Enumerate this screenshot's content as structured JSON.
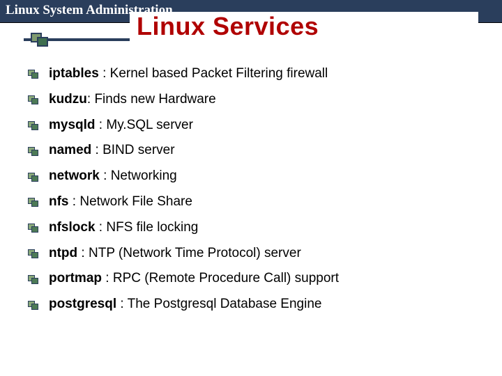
{
  "header": "Linux System Administration",
  "title": "Linux Services",
  "services": [
    {
      "name": "iptables",
      "sep": " : ",
      "desc": "Kernel based Packet Filtering firewall"
    },
    {
      "name": "kudzu",
      "sep": ": ",
      "desc": "Finds new Hardware"
    },
    {
      "name": "mysqld",
      "sep": " : ",
      "desc": "My.SQL server"
    },
    {
      "name": "named",
      "sep": " : ",
      "desc": "BIND server"
    },
    {
      "name": "network",
      "sep": " : ",
      "desc": "Networking"
    },
    {
      "name": "nfs",
      "sep": " : ",
      "desc": "Network File Share"
    },
    {
      "name": "nfslock",
      "sep": " : ",
      "desc": "NFS file locking"
    },
    {
      "name": "ntpd",
      "sep": " : ",
      "desc": "NTP (Network Time Protocol) server"
    },
    {
      "name": "portmap",
      "sep": " : ",
      "desc": "RPC (Remote Procedure Call) support"
    },
    {
      "name": "postgresql",
      "sep": " : ",
      "desc": "The Postgresql Database Engine"
    }
  ]
}
